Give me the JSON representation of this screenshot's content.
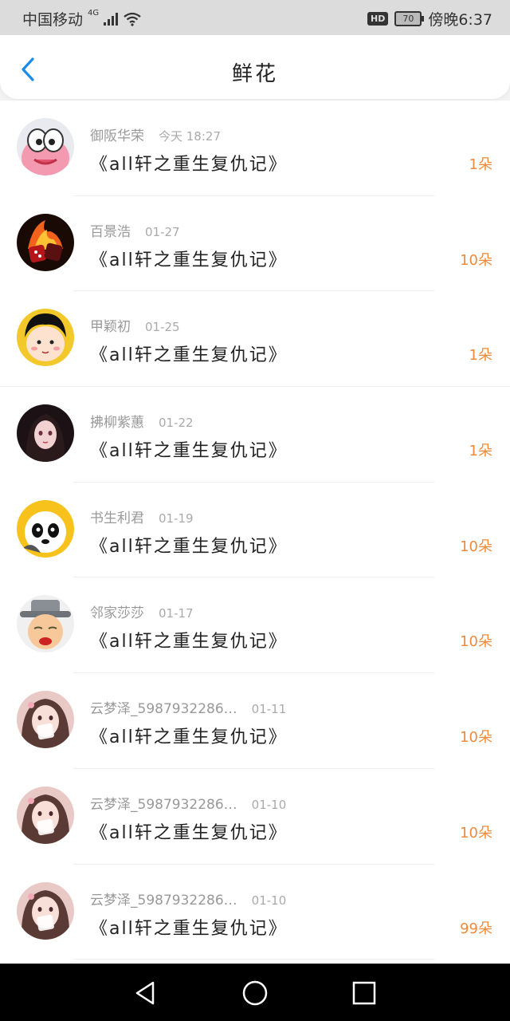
{
  "status_bar": {
    "carrier": "中国移动",
    "network": "4G",
    "hd": "HD",
    "battery": "70",
    "time": "傍晚6:37"
  },
  "header": {
    "title": "鲜花"
  },
  "items": [
    {
      "user": "御阪华荣",
      "time": "今天 18:27",
      "title": "《all轩之重生复仇记》",
      "count": "1朵"
    },
    {
      "user": "百景浩",
      "time": "01-27",
      "title": "《all轩之重生复仇记》",
      "count": "10朵"
    },
    {
      "user": "甲颖初",
      "time": "01-25",
      "title": "《all轩之重生复仇记》",
      "count": "1朵"
    },
    {
      "user": "拂柳紫蕙",
      "time": "01-22",
      "title": "《all轩之重生复仇记》",
      "count": "1朵"
    },
    {
      "user": "书生利君",
      "time": "01-19",
      "title": "《all轩之重生复仇记》",
      "count": "10朵"
    },
    {
      "user": "邻家莎莎",
      "time": "01-17",
      "title": "《all轩之重生复仇记》",
      "count": "10朵"
    },
    {
      "user": "云梦泽_5987932286…",
      "time": "01-11",
      "title": "《all轩之重生复仇记》",
      "count": "10朵"
    },
    {
      "user": "云梦泽_5987932286…",
      "time": "01-10",
      "title": "《all轩之重生复仇记》",
      "count": "10朵"
    },
    {
      "user": "云梦泽_5987932286…",
      "time": "01-10",
      "title": "《all轩之重生复仇记》",
      "count": "99朵"
    }
  ],
  "colors": {
    "accent": "#1a8ce8",
    "count": "#f08a3a"
  }
}
